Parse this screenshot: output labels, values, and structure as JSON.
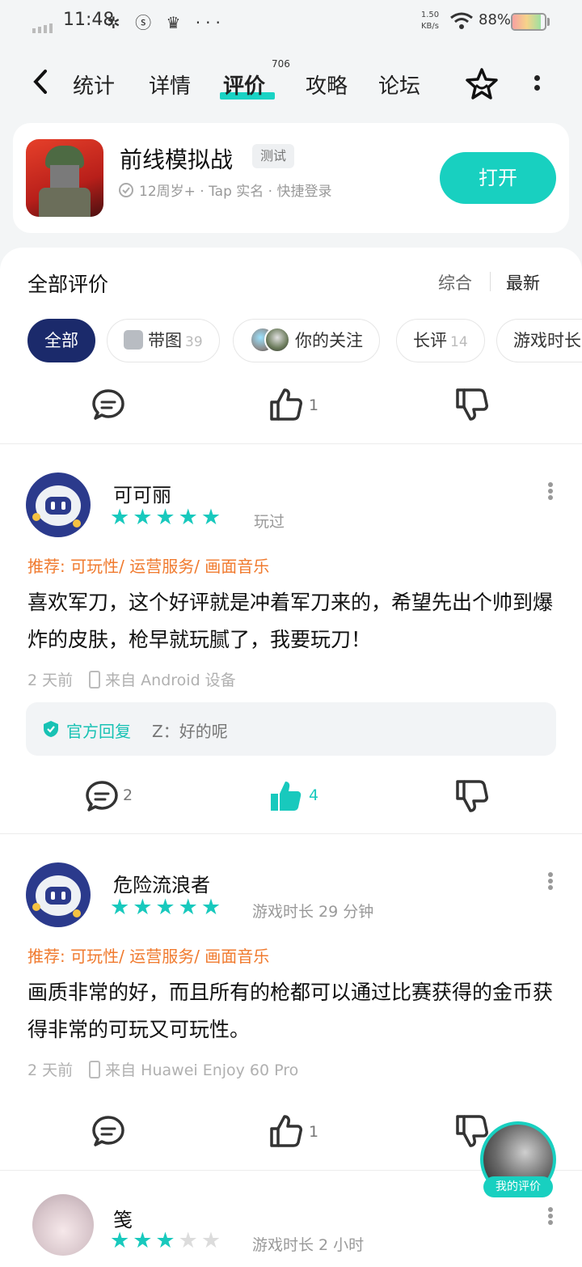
{
  "status_bar": {
    "time": "11:48",
    "icons": "✲ ⓢ ♛ ···",
    "speed_value": "1.50",
    "speed_unit": "KB/s",
    "battery": "88%"
  },
  "nav": {
    "tabs": [
      "统计",
      "详情",
      "评价",
      "攻略",
      "论坛"
    ],
    "active_tab": "评价",
    "review_count_badge": "706"
  },
  "game": {
    "title": "前线模拟战",
    "badge": "测试",
    "meta": "12周岁+ · Tap 实名 · 快捷登录",
    "open_label": "打开"
  },
  "reviews_header": {
    "title": "全部评价",
    "sort_options": [
      "综合",
      "最新"
    ]
  },
  "filters": [
    {
      "label": "全部",
      "count": ""
    },
    {
      "label": "带图",
      "count": "39"
    },
    {
      "label": "你的关注",
      "count": ""
    },
    {
      "label": "长评",
      "count": "14"
    },
    {
      "label": "游戏时长",
      "count": ""
    }
  ],
  "top_actions": {
    "like_count": "1"
  },
  "reviews": [
    {
      "username": "可可丽",
      "stars": 5,
      "played": "玩过",
      "recommend": "推荐: 可玩性/ 运营服务/ 画面音乐",
      "content": "喜欢军刀，这个好评就是冲着军刀来的，希望先出个帅到爆炸的皮肤，枪早就玩腻了，我要玩刀！",
      "time": "2 天前",
      "device": "来自 Android 设备",
      "reply_label": "官方回复",
      "reply_text": "Z：好的呢",
      "comment_count": "2",
      "like_count": "4"
    },
    {
      "username": "危险流浪者",
      "stars": 5,
      "played": "游戏时长 29 分钟",
      "recommend": "推荐: 可玩性/ 运营服务/ 画面音乐",
      "content": "画质非常的好，而且所有的枪都可以通过比赛获得的金币获得非常的可玩又可玩性。",
      "time": "2 天前",
      "device": "来自 Huawei Enjoy 60 Pro",
      "comment_count": "",
      "like_count": "1"
    },
    {
      "username": "笺",
      "stars": 3,
      "played": "游戏时长 2 小时"
    }
  ],
  "floating": {
    "label": "我的评价"
  },
  "colors": {
    "accent": "#18d0c0",
    "active_chip": "#1b2a6b",
    "recommend": "#f07a2e"
  }
}
